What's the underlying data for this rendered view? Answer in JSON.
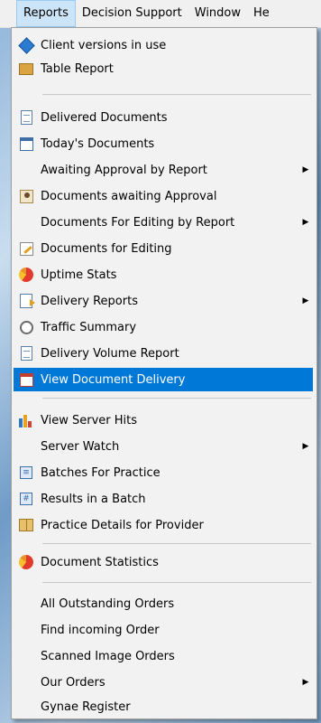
{
  "menubar": {
    "items": [
      "Reports",
      "Decision Support",
      "Window",
      "He"
    ]
  },
  "menu": {
    "items": [
      {
        "label": "Client versions in use",
        "icon": "client-versions-icon"
      },
      {
        "label": "Table Report",
        "icon": "table-report-icon"
      },
      {
        "label": "Delivered Documents",
        "icon": "delivered-documents-icon"
      },
      {
        "label": "Today's Documents",
        "icon": "calendar-icon"
      },
      {
        "label": "Awaiting Approval by Report",
        "submenu": true
      },
      {
        "label": "Documents awaiting Approval",
        "icon": "approval-person-icon"
      },
      {
        "label": "Documents For Editing by Report",
        "submenu": true
      },
      {
        "label": "Documents for Editing",
        "icon": "edit-pencil-icon"
      },
      {
        "label": "Uptime Stats",
        "icon": "pie-chart-icon"
      },
      {
        "label": "Delivery Reports",
        "icon": "delivery-reports-icon",
        "submenu": true
      },
      {
        "label": "Traffic Summary",
        "icon": "clock-icon"
      },
      {
        "label": "Delivery Volume Report",
        "icon": "volume-report-icon"
      },
      {
        "label": "View Document Delivery",
        "icon": "calendar-icon",
        "highlighted": true
      },
      {
        "label": "View Server Hits",
        "icon": "bar-chart-icon"
      },
      {
        "label": "Server Watch",
        "submenu": true
      },
      {
        "label": "Batches For Practice",
        "icon": "batch-icon"
      },
      {
        "label": "Results in a Batch",
        "icon": "batch-result-icon"
      },
      {
        "label": "Practice Details for Provider",
        "icon": "book-icon"
      },
      {
        "label": "Document Statistics",
        "icon": "pie-chart-icon"
      },
      {
        "label": "All Outstanding Orders"
      },
      {
        "label": "Find incoming Order"
      },
      {
        "label": "Scanned Image Orders"
      },
      {
        "label": "Our Orders",
        "submenu": true
      },
      {
        "label": "Gynae Register"
      }
    ]
  },
  "colors": {
    "highlight": "#0078d7",
    "menu_bg": "#f2f2f2"
  }
}
